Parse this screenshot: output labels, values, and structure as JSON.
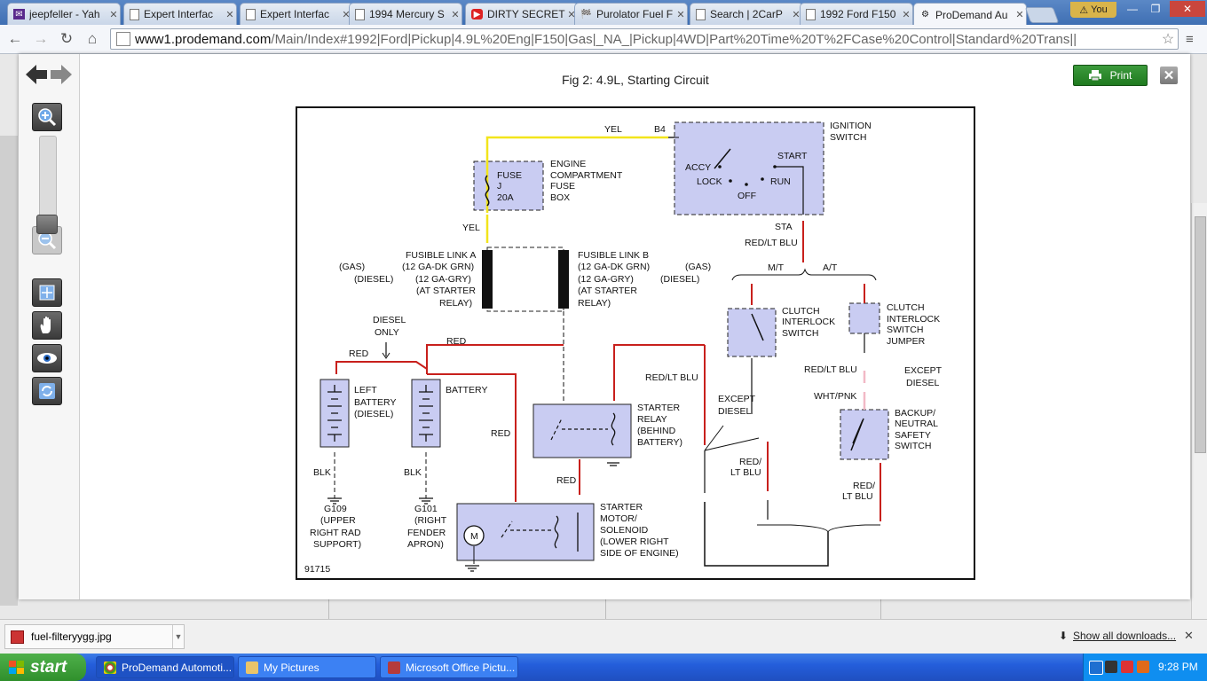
{
  "browser": {
    "tabs": [
      {
        "title": "jeepfeller - Yah",
        "icon": "mail-icon"
      },
      {
        "title": "Expert Interfac",
        "icon": "page-icon"
      },
      {
        "title": "Expert Interfac",
        "icon": "page-icon"
      },
      {
        "title": "1994 Mercury S",
        "icon": "page-icon"
      },
      {
        "title": "DIRTY SECRET",
        "icon": "youtube-icon"
      },
      {
        "title": "Purolator Fuel F",
        "icon": "flag-icon"
      },
      {
        "title": "Search | 2CarP",
        "icon": "page-icon"
      },
      {
        "title": "1992 Ford F150",
        "icon": "page-icon"
      },
      {
        "title": "ProDemand Au",
        "icon": "wrench-icon",
        "active": true
      }
    ],
    "tab_close": "✕",
    "user_button": "You",
    "window_controls": {
      "minimize": "—",
      "maximize": "❐",
      "close": "✕"
    },
    "url_host": "www1.prodemand.com",
    "url_path": "/Main/Index#1992|Ford|Pickup|4.9L%20Eng|F150|Gas|_NA_|Pickup|4WD|Part%20Time%20T%2FCase%20Control|Standard%20Trans||",
    "nav": {
      "back": "←",
      "forward": "→",
      "reload": "↻",
      "home": "⌂",
      "star": "☆",
      "menu": "≡"
    }
  },
  "viewer": {
    "figure_title": "Fig 2: 4.9L, Starting Circuit",
    "print_label": "Print",
    "close_label": "✕"
  },
  "diagram": {
    "figure_id": "91715",
    "labels": {
      "yel_top": "YEL",
      "b4": "B4",
      "ignition_switch": [
        "IGNITION",
        "SWITCH"
      ],
      "accy": "ACCY",
      "lock": "LOCK",
      "off": "OFF",
      "run": "RUN",
      "start": "START",
      "sta": "STA",
      "red_lt_blu_top": "RED/LT BLU",
      "mt": "M/T",
      "at": "A/T",
      "fuse": [
        "FUSE",
        "J",
        "20A"
      ],
      "fuse_box": [
        "ENGINE",
        "COMPARTMENT",
        "FUSE",
        "BOX"
      ],
      "yel_mid": "YEL",
      "fusible_a": [
        "FUSIBLE LINK A",
        "(12 GA-DK GRN)",
        "(12 GA-GRY)",
        "(AT STARTER",
        "RELAY)"
      ],
      "fusible_b": [
        "FUSIBLE LINK B",
        "(12 GA-DK GRN)",
        "(12 GA-GRY)",
        "(AT STARTER",
        "RELAY)"
      ],
      "gas_left": "(GAS)",
      "diesel_left": "(DIESEL)",
      "gas_right": "(GAS)",
      "diesel_right": "(DIESEL)",
      "clutch_interlock_switch": [
        "CLUTCH",
        "INTERLOCK",
        "SWITCH"
      ],
      "clutch_interlock_jumper": [
        "CLUTCH",
        "INTERLOCK",
        "SWITCH",
        "JUMPER"
      ],
      "diesel_only": [
        "DIESEL",
        "ONLY"
      ],
      "red_1": "RED",
      "red_2": "RED",
      "red_3": "RED",
      "red_4": "RED",
      "red_lt_blu_mid": "RED/LT BLU",
      "red_lt_blu_right": "RED/LT BLU",
      "except_diesel_1": [
        "EXCEPT",
        "DIESEL"
      ],
      "except_diesel_2": [
        "EXCEPT",
        "DIESEL"
      ],
      "wht_pnk": "WHT/PNK",
      "left_battery": [
        "LEFT",
        "BATTERY",
        "(DIESEL)"
      ],
      "battery": "BATTERY",
      "starter_relay": [
        "STARTER",
        "RELAY",
        "(BEHIND",
        "BATTERY)"
      ],
      "backup_switch": [
        "BACKUP/",
        "NEUTRAL",
        "SAFETY",
        "SWITCH"
      ],
      "red_lt_blu_low1": [
        "RED/",
        "LT BLU"
      ],
      "red_lt_blu_low2": [
        "RED/",
        "LT BLU"
      ],
      "blk_1": "BLK",
      "blk_2": "BLK",
      "g109": [
        "G109",
        "(UPPER",
        "RIGHT RAD",
        "SUPPORT)"
      ],
      "g101": [
        "G101",
        "(RIGHT",
        "FENDER",
        "APRON)"
      ],
      "starter_motor": [
        "STARTER",
        "MOTOR/",
        "SOLENOID",
        "(LOWER RIGHT",
        "SIDE OF ENGINE)"
      ],
      "motor_m": "M"
    },
    "colors": {
      "yellow": "#f2e51b",
      "red": "#c8201c",
      "component_fill": "#c9ccf2",
      "pink": "#f2b9c6"
    }
  },
  "downloads": {
    "file": "fuel-filteryygg.jpg",
    "show_all": "Show all downloads...",
    "close": "✕"
  },
  "taskbar": {
    "start": "start",
    "items": [
      {
        "label": "ProDemand Automoti...",
        "active": true
      },
      {
        "label": "My Pictures"
      },
      {
        "label": "Microsoft Office Pictu..."
      }
    ],
    "clock": "9:28 PM"
  }
}
